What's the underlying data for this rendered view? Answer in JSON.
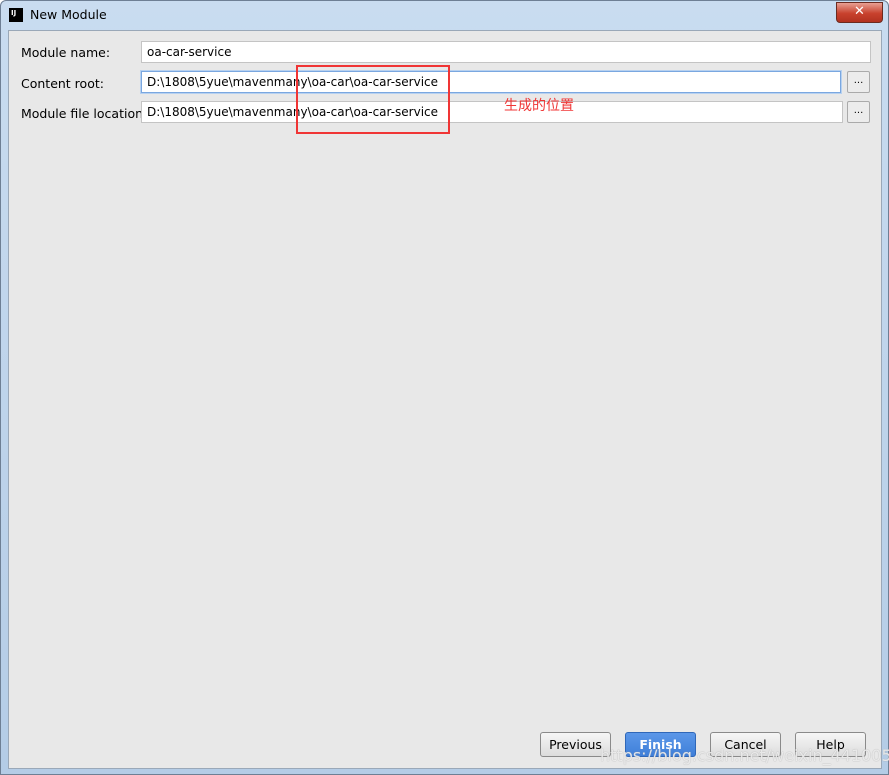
{
  "window": {
    "title": "New Module",
    "close_icon": "close-icon"
  },
  "form": {
    "module_name": {
      "label": "Module name:",
      "value": "oa-car-service"
    },
    "content_root": {
      "label": "Content root:",
      "value": "D:\\1808\\5yue\\mavenmany\\oa-car\\oa-car-service",
      "browse": "..."
    },
    "module_file_location": {
      "label": "Module file location:",
      "value": "D:\\1808\\5yue\\mavenmany\\oa-car\\oa-car-service",
      "browse": "..."
    }
  },
  "annotation": {
    "text": "生成的位置",
    "color": "#f03535"
  },
  "buttons": {
    "previous": "Previous",
    "finish": "Finish",
    "cancel": "Cancel",
    "help": "Help"
  },
  "watermark": "https://blog.csdn.net/weixin_44100514"
}
